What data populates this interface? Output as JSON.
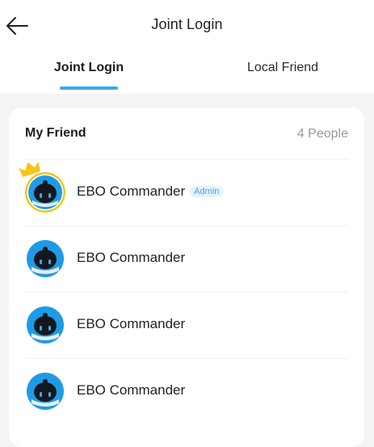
{
  "header": {
    "title": "Joint Login"
  },
  "tabs": [
    {
      "label": "Joint Login",
      "active": true
    },
    {
      "label": "Local Friend",
      "active": false
    }
  ],
  "friends_card": {
    "title": "My Friend",
    "count": "4 People",
    "friends": [
      {
        "name": "EBO Commander",
        "badge": "Admin",
        "is_admin": true
      },
      {
        "name": "EBO Commander",
        "badge": "",
        "is_admin": false
      },
      {
        "name": "EBO Commander",
        "badge": "",
        "is_admin": false
      },
      {
        "name": "EBO Commander",
        "badge": "",
        "is_admin": false
      }
    ]
  },
  "icons": {
    "back": "arrow-left-icon",
    "avatar": "ebo-robot-avatar-icon",
    "crown": "crown-icon"
  },
  "colors": {
    "accent": "#3aa8ee",
    "admin_ring": "#f5c518",
    "crown": "#f5c518",
    "muted_text": "#9a9a9a",
    "background": "#f4f4f5"
  }
}
